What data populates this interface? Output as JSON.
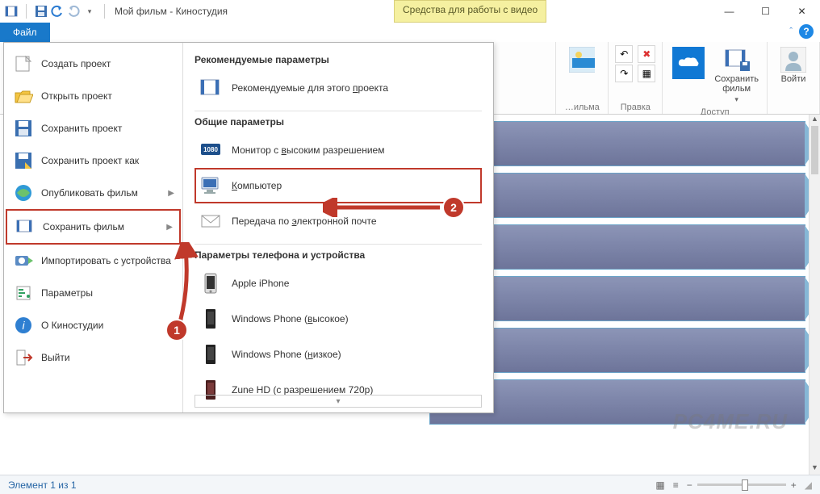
{
  "titlebar": {
    "app_title": "Мой фильм - Киностудия",
    "context_tab": "Средства для работы с видео"
  },
  "tabs": {
    "file": "Файл"
  },
  "ribbon": {
    "group_movie_label": "…ильма",
    "group_edit_label": "Правка",
    "group_access_label": "Доступ",
    "save_movie": "Сохранить\nфильм",
    "signin": "Войти"
  },
  "file_menu": {
    "left": [
      {
        "label": "Создать проект"
      },
      {
        "label": "Открыть проект"
      },
      {
        "label": "Сохранить проект"
      },
      {
        "label": "Сохранить проект как"
      },
      {
        "label": "Опубликовать фильм",
        "submenu": true
      },
      {
        "label": "Сохранить фильм",
        "submenu": true,
        "selected": true
      },
      {
        "label": "Импортировать с устройства"
      },
      {
        "label": "Параметры"
      },
      {
        "label": "О Киностудии"
      },
      {
        "label": "Выйти"
      }
    ],
    "right": {
      "h1": "Рекомендуемые параметры",
      "recommended": "Рекомендуемые для этого проекта",
      "h2": "Общие параметры",
      "hd": "Монитор с высоким разрешением",
      "computer": "Компьютер",
      "email": "Передача по электронной почте",
      "h3": "Параметры телефона и устройства",
      "iphone": "Apple iPhone",
      "wp_high": "Windows Phone (высокое)",
      "wp_low": "Windows Phone (низкое)",
      "zune": "Zune HD (с разрешением 720p)"
    }
  },
  "annotations": {
    "step1": "1",
    "step2": "2"
  },
  "status": {
    "item_count": "Элемент 1 из 1"
  },
  "watermark": "PC4ME.RU"
}
